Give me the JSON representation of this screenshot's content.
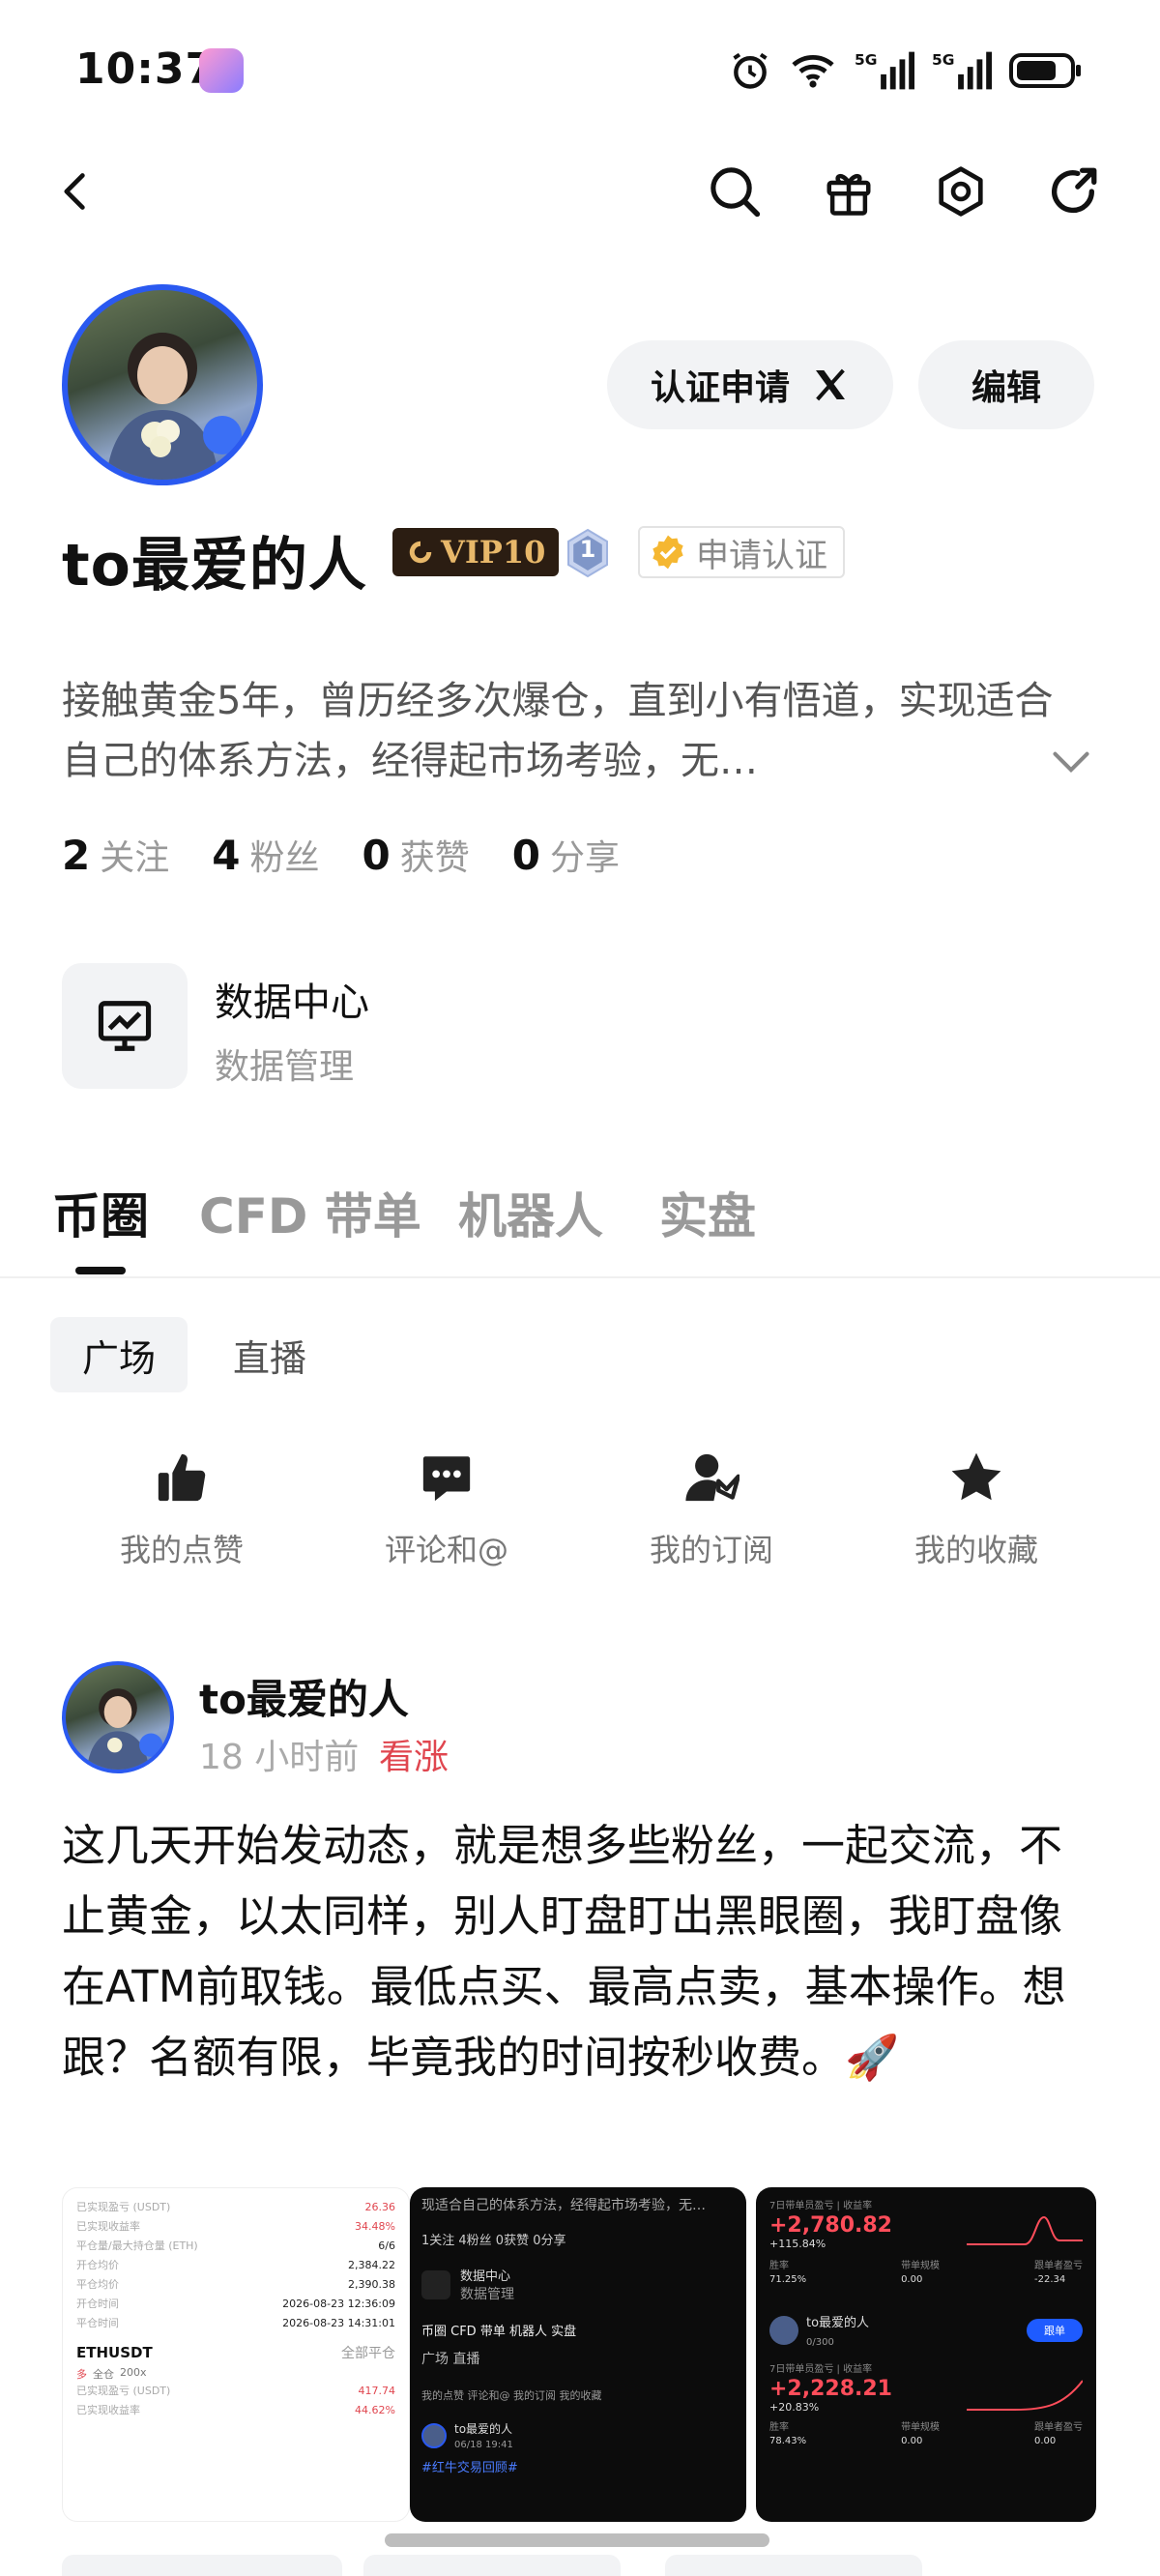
{
  "status_bar": {
    "time": "10:37",
    "battery": "battery-icon"
  },
  "top_bar": {
    "icons": [
      "back-icon",
      "search-icon",
      "gift-icon",
      "settings-icon",
      "share-icon"
    ]
  },
  "profile": {
    "cert_button": "认证申请",
    "edit_button": "编辑",
    "username": "to最爱的人",
    "vip": "VIP10",
    "level": "1",
    "cert_badge": "申请认证",
    "bio": "接触黄金5年，曾历经多次爆仓，直到小有悟道，实现适合自己的体系方法，经得起市场考验，无…",
    "stats": [
      {
        "value": "2",
        "label": "关注"
      },
      {
        "value": "4",
        "label": "粉丝"
      },
      {
        "value": "0",
        "label": "获赞"
      },
      {
        "value": "0",
        "label": "分享"
      }
    ],
    "data_center": {
      "title": "数据中心",
      "subtitle": "数据管理"
    }
  },
  "tabs": [
    "币圈",
    "CFD 带单",
    "机器人",
    "实盘"
  ],
  "subtabs": [
    "广场",
    "直播"
  ],
  "quick_actions": [
    {
      "label": "我的点赞",
      "icon": "thumbs-up-icon"
    },
    {
      "label": "评论和@",
      "icon": "comment-icon"
    },
    {
      "label": "我的订阅",
      "icon": "subscribe-icon"
    },
    {
      "label": "我的收藏",
      "icon": "star-icon"
    }
  ],
  "post": {
    "author": "to最爱的人",
    "time": "18 小时前",
    "sentiment": "看涨",
    "text": "这几天开始发动态，就是想多些粉丝，一起交流，不止黄金，以太同样，别人盯盘盯出黑眼圈，我盯盘像在ATM前取钱。最低点买、最高点卖，基本操作。想跟？名额有限，毕竟我的时间按秒收费。🚀",
    "thumb1": {
      "rows": [
        {
          "k": "已实现盈亏 (USDT)",
          "v": "26.36"
        },
        {
          "k": "已实现收益率",
          "v": "34.48%"
        },
        {
          "k": "平仓量/最大持仓量 (ETH)",
          "v": "6/6"
        },
        {
          "k": "开仓均价",
          "v": "2,384.22"
        },
        {
          "k": "平仓均价",
          "v": "2,390.38"
        },
        {
          "k": "开仓时间",
          "v": "2026-08-23 12:36:09"
        },
        {
          "k": "平仓时间",
          "v": "2026-08-23 14:31:01"
        }
      ],
      "symbol": "ETHUSDT",
      "symbol_sub": "全部平仓",
      "tags": [
        "多",
        "全仓",
        "200x"
      ],
      "rows2": [
        {
          "k": "已实现盈亏 (USDT)",
          "v": "417.74"
        },
        {
          "k": "已实现收益率",
          "v": "44.62%"
        }
      ]
    },
    "thumb2": {
      "bio_line": "现适合自己的体系方法，经得起市场考验，无…",
      "stats_line": "1关注  4粉丝  0获赞  0分享",
      "dc_title": "数据中心",
      "dc_sub": "数据管理",
      "tabs_line": "币圈  CFD 带单  机器人  实盘",
      "subtabs_line": "广场  直播",
      "actions_line": "我的点赞  评论和@  我的订阅  我的收藏",
      "author": "to最爱的人",
      "date": "06/18 19:41",
      "tag": "#红牛交易回顾#"
    },
    "thumb3": {
      "label1": "7日带单员盈亏 | 收益率",
      "pnl1": "+2,780.82",
      "pct1": "+115.84%",
      "m1": [
        {
          "k": "胜率",
          "v": "71.25%"
        },
        {
          "k": "带单规模",
          "v": "0.00"
        },
        {
          "k": "跟单者盈亏",
          "v": "-22.34"
        }
      ],
      "trader": "to最爱的人",
      "trader_sub": "0/300",
      "follow": "跟单",
      "label2": "7日带单员盈亏 | 收益率",
      "pnl2": "+2,228.21",
      "pct2": "+20.83%",
      "m2": [
        {
          "k": "胜率",
          "v": "78.43%"
        },
        {
          "k": "带单规模",
          "v": "0.00"
        },
        {
          "k": "跟单者盈亏",
          "v": "0.00"
        }
      ]
    }
  },
  "colors": {
    "accent_blue": "#2a59f0",
    "bullish_red": "#e0464f",
    "vip_gold": "#e8b86a"
  }
}
